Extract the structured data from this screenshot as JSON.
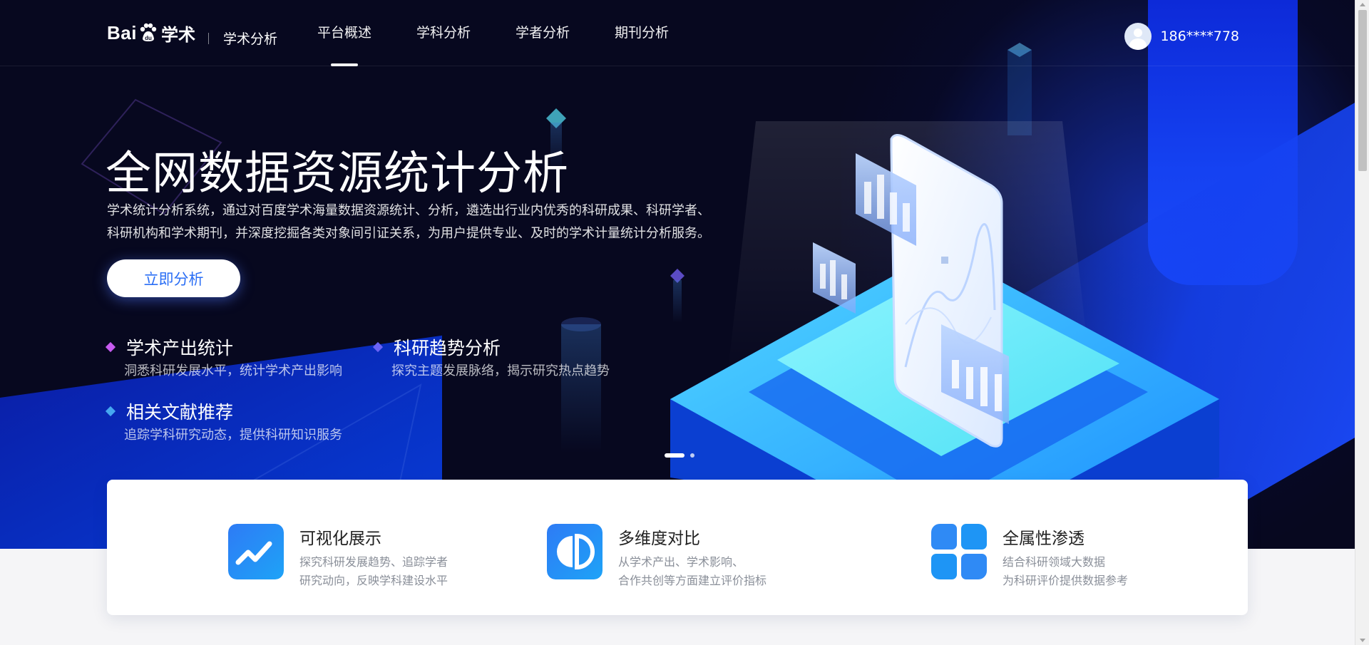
{
  "brand": {
    "logo_text": "Bai",
    "logo_cn": "学术",
    "product": "学术分析"
  },
  "nav": {
    "items": [
      {
        "label": "平台概述",
        "active": true
      },
      {
        "label": "学科分析",
        "active": false
      },
      {
        "label": "学者分析",
        "active": false
      },
      {
        "label": "期刊分析",
        "active": false
      }
    ]
  },
  "user": {
    "name": "186****778"
  },
  "hero": {
    "title": "全网数据资源统计分析",
    "desc_line1": "学术统计分析系统，通过对百度学术海量数据资源统计、分析，遴选出行业内优秀的科研成果、科研学者、",
    "desc_line2": "科研机构和学术期刊，并深度挖掘各类对象间引证关系，为用户提供专业、及时的学术计量统计分析服务。",
    "cta": "立即分析",
    "features": [
      {
        "title": "学术产出统计",
        "desc": "洞悉科研发展水平，统计学术产出影响",
        "color": "#c65bf0"
      },
      {
        "title": "科研趋势分析",
        "desc": "探究主题发展脉络，揭示研究热点趋势",
        "color": "#6b63f5"
      },
      {
        "title": "相关文献推荐",
        "desc": "追踪学科研究动态，提供科研知识服务",
        "color": "#46a7f0"
      }
    ],
    "carousel": {
      "total": 2,
      "current": 1
    }
  },
  "highlights": [
    {
      "title": "可视化展示",
      "line1": "探究科研发展趋势、追踪学者",
      "line2": "研究动向，反映学科建设水平",
      "icon": "trend-chart-icon"
    },
    {
      "title": "多维度对比",
      "line1": "从学术产出、学术影响、",
      "line2": "合作共创等方面建立评价指标",
      "icon": "half-circle-compare-icon"
    },
    {
      "title": "全属性渗透",
      "line1": "结合科研领域大数据",
      "line2": "为科研评价提供数据参考",
      "icon": "grid-tiles-icon"
    }
  ],
  "colors": {
    "hero_bg": "#07081f",
    "accent_blue": "#2a6ef5",
    "card_icon_blue": "#1e8cf7"
  }
}
